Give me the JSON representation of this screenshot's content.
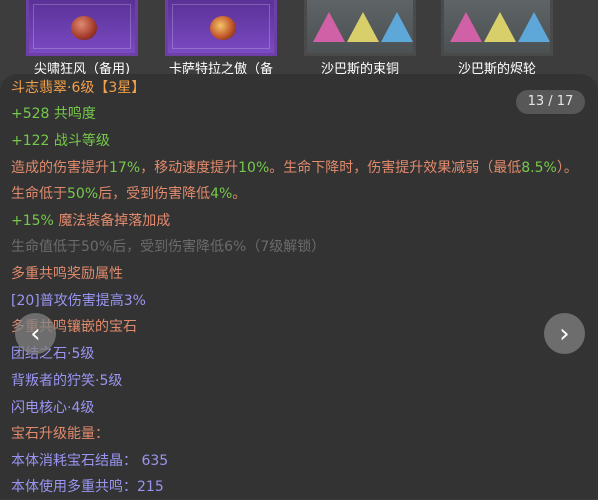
{
  "items": [
    {
      "label": "尖啸狂风（备用)"
    },
    {
      "label": "卡萨特拉之傲（备"
    },
    {
      "label": "沙巴斯的束铜"
    },
    {
      "label": "沙巴斯的烬轮"
    }
  ],
  "detail": {
    "title": "斗志翡翠·6级",
    "stars": "【3星】",
    "counter": "13 / 17",
    "resonance": "+528 共鸣度",
    "combat_level": "+122 战斗等级",
    "effect_prefix": "造成的伤害提升",
    "effect_val1": "17%",
    "effect_mid1": "，移动速度提升",
    "effect_val2": "10%",
    "effect_mid2": "。生命下降时，伤害提升效果减弱（最低",
    "effect_val3": "8.5%",
    "effect_mid3": "）。生命低于",
    "effect_val4": "50%",
    "effect_mid4": "后，受到伤害降低",
    "effect_val5": "4%",
    "effect_suffix": "。",
    "drop_val": "+15%",
    "drop_text": "魔法装备掉落加成",
    "locked_effect": "生命值低于50%后，受到伤害降低6%（7级解锁）",
    "multi_reward_title": "多重共鸣奖励属性",
    "multi_reward_item": "[20]普攻伤害提高3%",
    "socketed_title": "多重共鸣镶嵌的宝石",
    "gems": [
      "团结之石·5级",
      "背叛者的狞笑·5级",
      "闪电核心·4级"
    ],
    "upgrade_title": "宝石升级能量：",
    "upgrade_lines": [
      "本体消耗宝石结晶： 635",
      "本体使用多重共鸣：215"
    ]
  },
  "nav": {
    "prev": "‹",
    "next": "›"
  },
  "colors": {
    "title": "#f3a04a",
    "value": "#76c94a",
    "desc": "#e18a6c",
    "locked": "#6b6b6b",
    "gem": "#9a95f2",
    "thumb_purple": "#6f3fa8"
  }
}
